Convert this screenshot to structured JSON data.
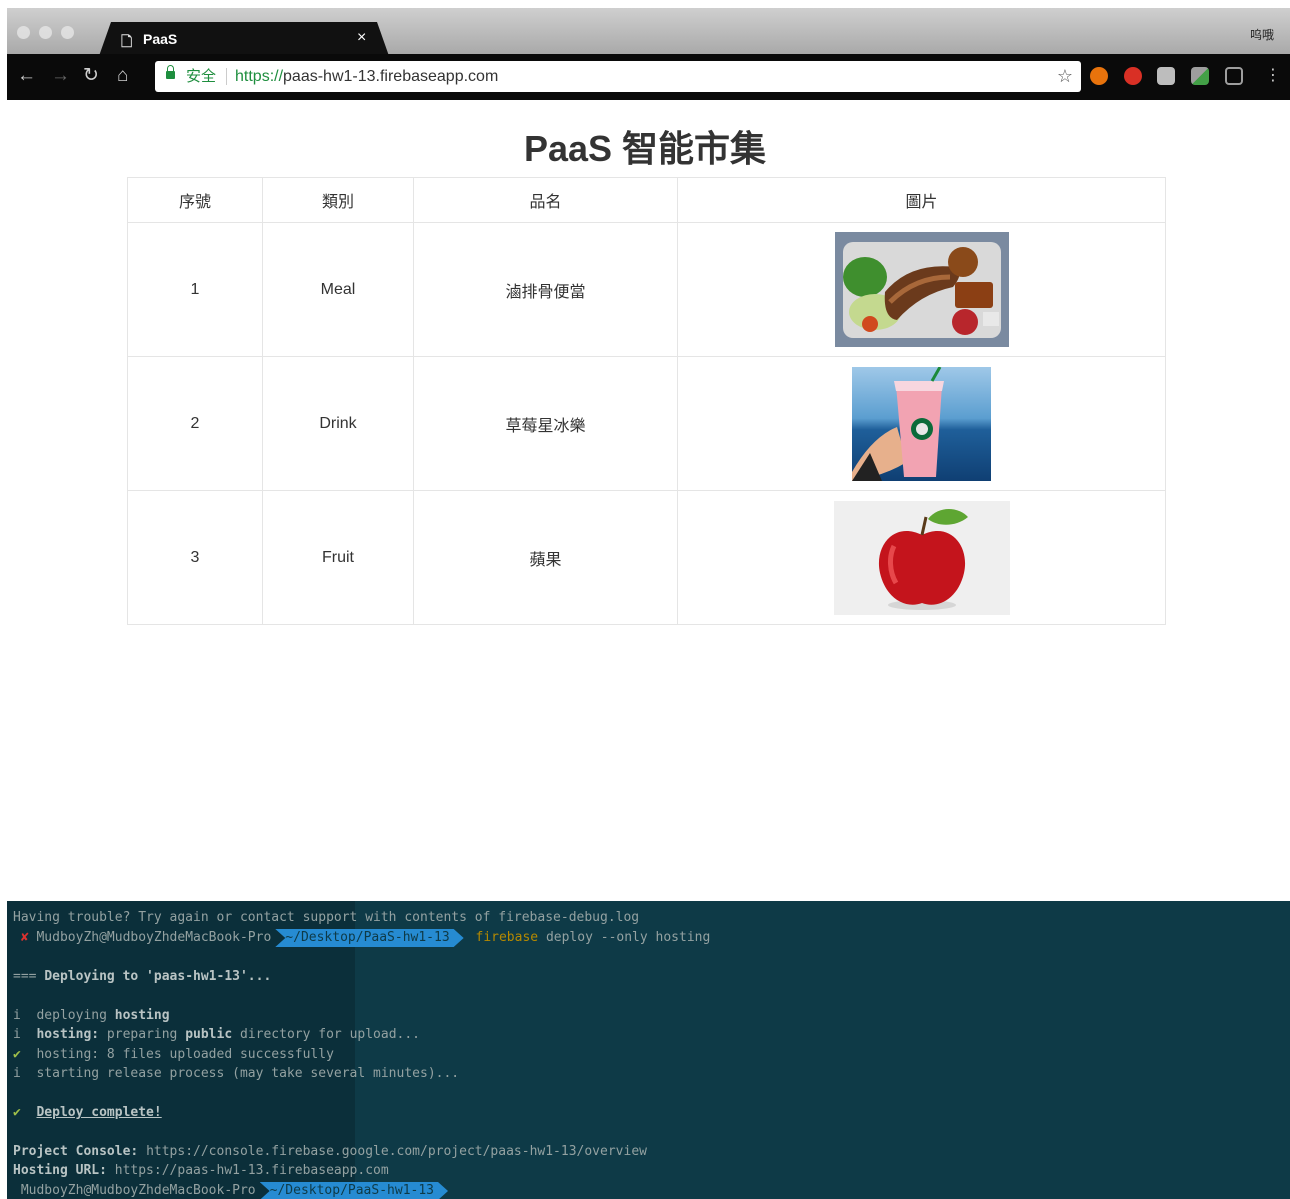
{
  "browser": {
    "tab_title": "PaaS",
    "tab_close": "×",
    "user_name": "呜哦",
    "security_label": "安全",
    "url_scheme": "https://",
    "url_host": "paas-hw1-13.firebaseapp.com"
  },
  "page": {
    "title": "PaaS 智能市集",
    "columns": [
      "序號",
      "類別",
      "品名",
      "圖片"
    ],
    "rows": [
      {
        "index": "1",
        "category": "Meal",
        "name": "滷排骨便當",
        "image": "pork-chop-bento"
      },
      {
        "index": "2",
        "category": "Drink",
        "name": "草莓星冰樂",
        "image": "strawberry-frappuccino"
      },
      {
        "index": "3",
        "category": "Fruit",
        "name": "蘋果",
        "image": "red-apple"
      }
    ]
  },
  "terminal": {
    "line1": "Having trouble? Try again or contact support with contents of firebase-debug.log",
    "prompt_mark": "✘",
    "prompt_host": "MudboyZh@MudboyZhdeMacBook-Pro",
    "prompt_path": "~/Desktop/PaaS-hw1-13",
    "cmd_name": "firebase",
    "cmd_args": "deploy --only hosting",
    "deploy_prefix": "===",
    "deploy_text": "Deploying to 'paas-hw1-13'...",
    "l_info1_a": "i  deploying ",
    "l_info1_b": "hosting",
    "l_info2_a": "i  ",
    "l_info2_b": "hosting:",
    "l_info2_c": " preparing ",
    "l_info2_d": "public",
    "l_info2_e": " directory for upload...",
    "l_ok1_mark": "✔",
    "l_ok1_text": "  hosting: 8 files uploaded successfully",
    "l_info3": "i  starting release process (may take several minutes)...",
    "done_mark": "✔",
    "done_text": "Deploy complete!",
    "console_label": "Project Console:",
    "console_url": "https://console.firebase.google.com/project/paas-hw1-13/overview",
    "hosting_label": "Hosting URL:",
    "hosting_url": "https://paas-hw1-13.firebaseapp.com"
  }
}
